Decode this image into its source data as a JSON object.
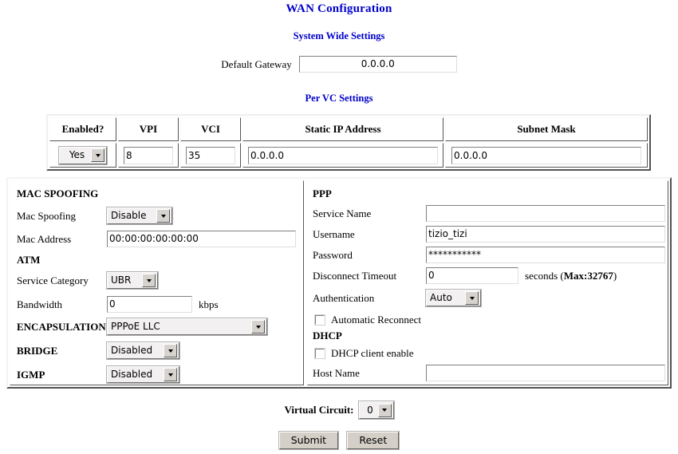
{
  "page": {
    "title": "WAN Configuration",
    "system_wide_heading": "System Wide Settings",
    "per_vc_heading": "Per VC Settings",
    "heading_color": "#0000cc"
  },
  "system_wide": {
    "default_gateway_label": "Default Gateway",
    "default_gateway_value": "0.0.0.0"
  },
  "vc_table": {
    "headers": [
      "Enabled?",
      "VPI",
      "VCI",
      "Static IP Address",
      "Subnet Mask"
    ],
    "row": {
      "enabled": "Yes",
      "vpi": "8",
      "vci": "35",
      "static_ip": "0.0.0.0",
      "subnet_mask": "0.0.0.0"
    }
  },
  "mac_spoofing": {
    "heading": "MAC SPOOFING",
    "spoofing_label": "Mac Spoofing",
    "spoofing_value": "Disable",
    "address_label": "Mac Address",
    "address_value": "00:00:00:00:00:00"
  },
  "atm": {
    "heading": "ATM",
    "service_category_label": "Service Category",
    "service_category_value": "UBR",
    "bandwidth_label": "Bandwidth",
    "bandwidth_value": "0",
    "bandwidth_unit": "kbps"
  },
  "encapsulation": {
    "label": "ENCAPSULATION",
    "value": "PPPoE LLC"
  },
  "bridge": {
    "label": "BRIDGE",
    "value": "Disabled"
  },
  "igmp": {
    "label": "IGMP",
    "value": "Disabled"
  },
  "ppp": {
    "heading": "PPP",
    "service_name_label": "Service Name",
    "service_name_value": "",
    "username_label": "Username",
    "username_value": "tizio_tizi",
    "password_label": "Password",
    "password_value": "***********",
    "disconnect_timeout_label": "Disconnect Timeout",
    "disconnect_timeout_value": "0",
    "disconnect_timeout_unit": "seconds (",
    "disconnect_timeout_max": "Max:32767",
    "disconnect_timeout_unit_end": ")",
    "authentication_label": "Authentication",
    "authentication_value": "Auto",
    "automatic_reconnect_label": "Automatic Reconnect",
    "automatic_reconnect_checked": false
  },
  "dhcp": {
    "heading": "DHCP",
    "client_enable_label": "DHCP client enable",
    "client_enable_checked": false,
    "host_name_label": "Host Name",
    "host_name_value": ""
  },
  "footer": {
    "virtual_circuit_label": "Virtual Circuit:",
    "virtual_circuit_value": "0",
    "submit_label": "Submit",
    "reset_label": "Reset"
  }
}
